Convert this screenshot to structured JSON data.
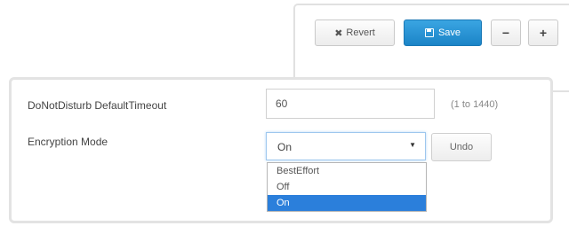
{
  "toolbar": {
    "revert_label": "Revert",
    "revert_icon": "x-icon",
    "save_label": "Save",
    "save_icon": "floppy-disk-icon",
    "minus_label": "−",
    "plus_label": "+"
  },
  "settings": {
    "dnd": {
      "label": "DoNotDisturb DefaultTimeout",
      "value": "60",
      "range_hint": "(1 to 1440)"
    },
    "encryption": {
      "label": "Encryption Mode",
      "selected": "On",
      "undo_label": "Undo",
      "options": [
        "BestEffort",
        "Off",
        "On"
      ],
      "highlighted_option": "On"
    }
  },
  "colors": {
    "save_button": "#1f8ad0",
    "selected_option": "#2b7fdb",
    "panel_border": "#e3e3e3"
  }
}
